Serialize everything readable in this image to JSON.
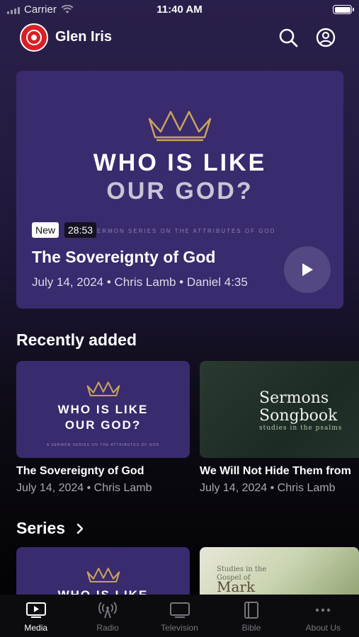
{
  "status_bar": {
    "carrier": "Carrier",
    "time": "11:40 AM"
  },
  "header": {
    "title": "Glen Iris"
  },
  "hero": {
    "art_line1": "WHO IS LIKE",
    "art_line2": "OUR GOD?",
    "art_subline": "A SERMON SERIES ON THE ATTRIBUTES OF GOD",
    "badge_new": "New",
    "duration": "28:53",
    "title": "The Sovereignty of God",
    "meta": "July 14, 2024 • Chris Lamb • Daniel 4:35"
  },
  "recently_added": {
    "heading": "Recently added",
    "items": [
      {
        "art_line1": "WHO IS LIKE",
        "art_line2": "OUR GOD?",
        "art_subline": "A SERMON SERIES ON THE ATTRIBUTES OF GOD",
        "title": "The Sovereignty of God",
        "meta": "July 14, 2024 • Chris Lamb"
      },
      {
        "art_line1": "Sermons",
        "art_line2": "Songbook",
        "art_subline": "studies in the psalms",
        "title": "We Will Not Hide Them from",
        "meta": "July 14, 2024 • Chris Lamb"
      }
    ]
  },
  "series": {
    "heading": "Series",
    "items": [
      {
        "art_line1": "WHO IS LIKE"
      },
      {
        "art_line1": "Studies in the",
        "art_line2": "Gospel of",
        "art_line3": "Mark"
      }
    ]
  },
  "tabs": [
    {
      "label": "Media",
      "icon": "media-icon"
    },
    {
      "label": "Radio",
      "icon": "radio-icon"
    },
    {
      "label": "Television",
      "icon": "television-icon"
    },
    {
      "label": "Bible",
      "icon": "bible-icon"
    },
    {
      "label": "About Us",
      "icon": "more-icon"
    }
  ],
  "colors": {
    "accent": "#3a2a6e",
    "logo": "#d81f26",
    "crown": "#c8a55a"
  }
}
